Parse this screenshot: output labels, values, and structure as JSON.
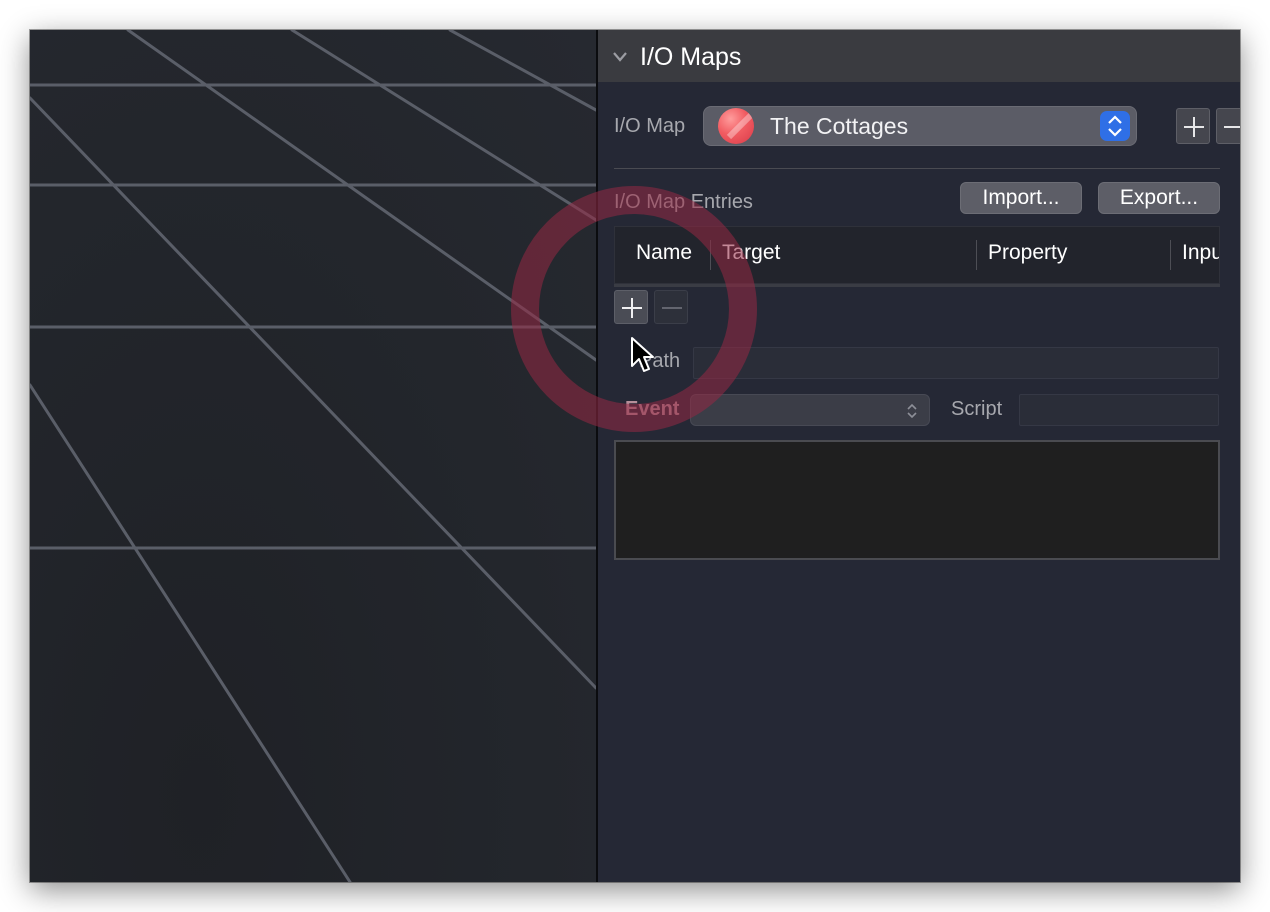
{
  "panel": {
    "title": "I/O Maps",
    "io_map_label": "I/O Map",
    "selected_map": "The Cottages",
    "entries_label": "I/O Map Entries",
    "import_label": "Import...",
    "export_label": "Export...",
    "columns": [
      "Name",
      "Target",
      "Property",
      "Inpu"
    ],
    "path_label": "Path",
    "path_value": "",
    "event_label": "Event",
    "event_value": "",
    "script_label": "Script",
    "script_value": ""
  },
  "icons": {
    "disclosure": "chevron-down-icon",
    "map_icon": "red-ball-icon",
    "stepper": "up-down-stepper-icon",
    "add": "plus-icon",
    "remove": "minus-icon",
    "cursor": "mouse-pointer-icon"
  },
  "colors": {
    "panel_background": "#252835",
    "header_background": "#3a3b40",
    "accent_blue": "#2f6fe6",
    "highlight_ring": "#962844",
    "map_icon_red": "#f15c62"
  }
}
